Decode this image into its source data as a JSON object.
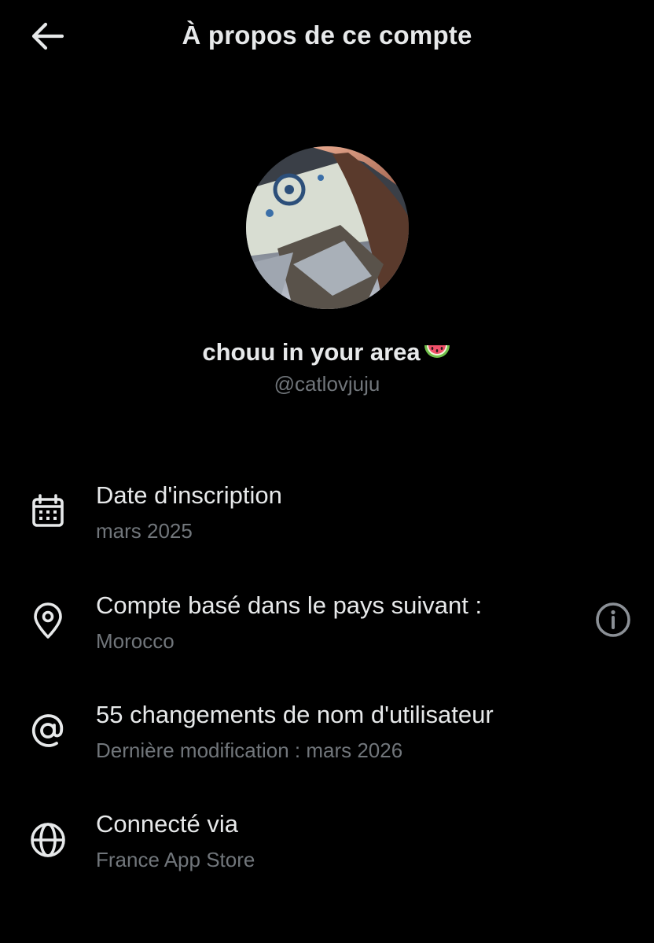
{
  "header": {
    "title": "À propos de ce compte",
    "back_icon": "arrow-left-icon"
  },
  "profile": {
    "display_name": "chouu in your area",
    "emoji": "watermelon",
    "handle": "@catlovjuju"
  },
  "rows": [
    {
      "icon": "calendar-icon",
      "title": "Date d'inscription",
      "subtitle": "mars 2025"
    },
    {
      "icon": "location-pin-icon",
      "title": "Compte basé dans le pays suivant :",
      "subtitle": "Morocco",
      "trailing_icon": "info-icon"
    },
    {
      "icon": "at-sign-icon",
      "title": "55 changements de nom d'utilisateur",
      "subtitle": "Dernière modification : mars 2026"
    },
    {
      "icon": "globe-icon",
      "title": "Connecté via",
      "subtitle": "France App Store"
    }
  ],
  "colors": {
    "background": "#000000",
    "primary_text": "#e7e9ea",
    "secondary_text": "#71767b"
  }
}
